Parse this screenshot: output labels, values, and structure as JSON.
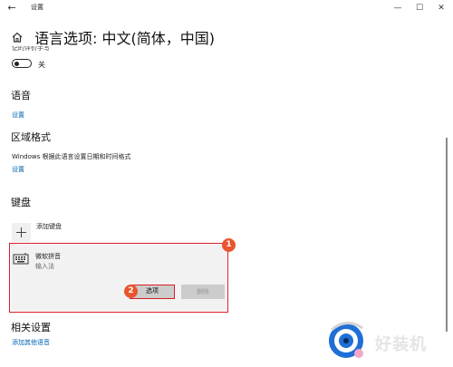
{
  "window": {
    "title": "设置",
    "back_glyph": "←",
    "minimize_glyph": "—",
    "maximize_glyph": "☐",
    "close_glyph": "✕"
  },
  "header": {
    "page_title": "语言选项: 中文(简体，中国)",
    "home_icon": "home-icon"
  },
  "handwriting": {
    "cut_label": "记的评价手写",
    "toggle_state": "off",
    "toggle_label": "关"
  },
  "sections": {
    "language": {
      "heading": "语音",
      "link": "设置"
    },
    "region": {
      "heading": "区域格式",
      "description": "Windows 根据此语言设置日期和时间格式",
      "link": "设置"
    },
    "keyboard": {
      "heading": "键盘",
      "add_label": "添加键盘",
      "ime": {
        "name": "微软拼音",
        "type": "输入法",
        "options_button": "选项",
        "remove_button": "删除"
      }
    },
    "related": {
      "heading": "相关设置",
      "link": "添加其他语音"
    }
  },
  "annotations": {
    "badge_1": "1",
    "badge_2": "2",
    "highlight_color": "#d81f26",
    "badge_color": "#e8552f"
  },
  "watermark": {
    "text": "好装机"
  },
  "colors": {
    "link": "#0063b1",
    "card_bg": "#f2f2f2",
    "button_bg": "#cccccc"
  }
}
